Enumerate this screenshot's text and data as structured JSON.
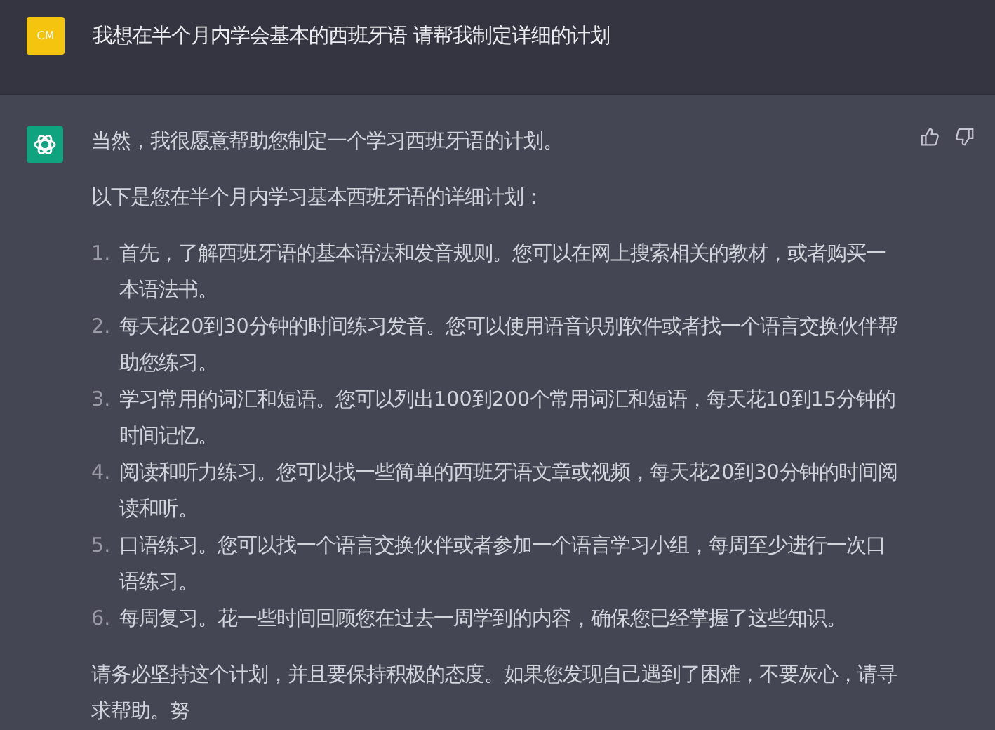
{
  "user_message": {
    "avatar": "CM",
    "text": "我想在半个月内学会基本的西班牙语 请帮我制定详细的计划"
  },
  "assistant_message": {
    "intro": "当然，我很愿意帮助您制定一个学习西班牙语的计划。",
    "lead": "以下是您在半个月内学习基本西班牙语的详细计划：",
    "steps": [
      {
        "number": "1.",
        "text": "首先，了解西班牙语的基本语法和发音规则。您可以在网上搜索相关的教材，或者购买一本语法书。"
      },
      {
        "number": "2.",
        "text": "每天花20到30分钟的时间练习发音。您可以使用语音识别软件或者找一个语言交换伙伴帮助您练习。"
      },
      {
        "number": "3.",
        "text": "学习常用的词汇和短语。您可以列出100到200个常用词汇和短语，每天花10到15分钟的时间记忆。"
      },
      {
        "number": "4.",
        "text": "阅读和听力练习。您可以找一些简单的西班牙语文章或视频，每天花20到30分钟的时间阅读和听。"
      },
      {
        "number": "5.",
        "text": "口语练习。您可以找一个语言交换伙伴或者参加一个语言学习小组，每周至少进行一次口语练习。"
      },
      {
        "number": "6.",
        "text": "每周复习。花一些时间回顾您在过去一周学到的内容，确保您已经掌握了这些知识。"
      }
    ],
    "closing": "请务必坚持这个计划，并且要保持积极的态度。如果您发现自己遇到了困难，不要灰心，请寻求帮助。努"
  }
}
